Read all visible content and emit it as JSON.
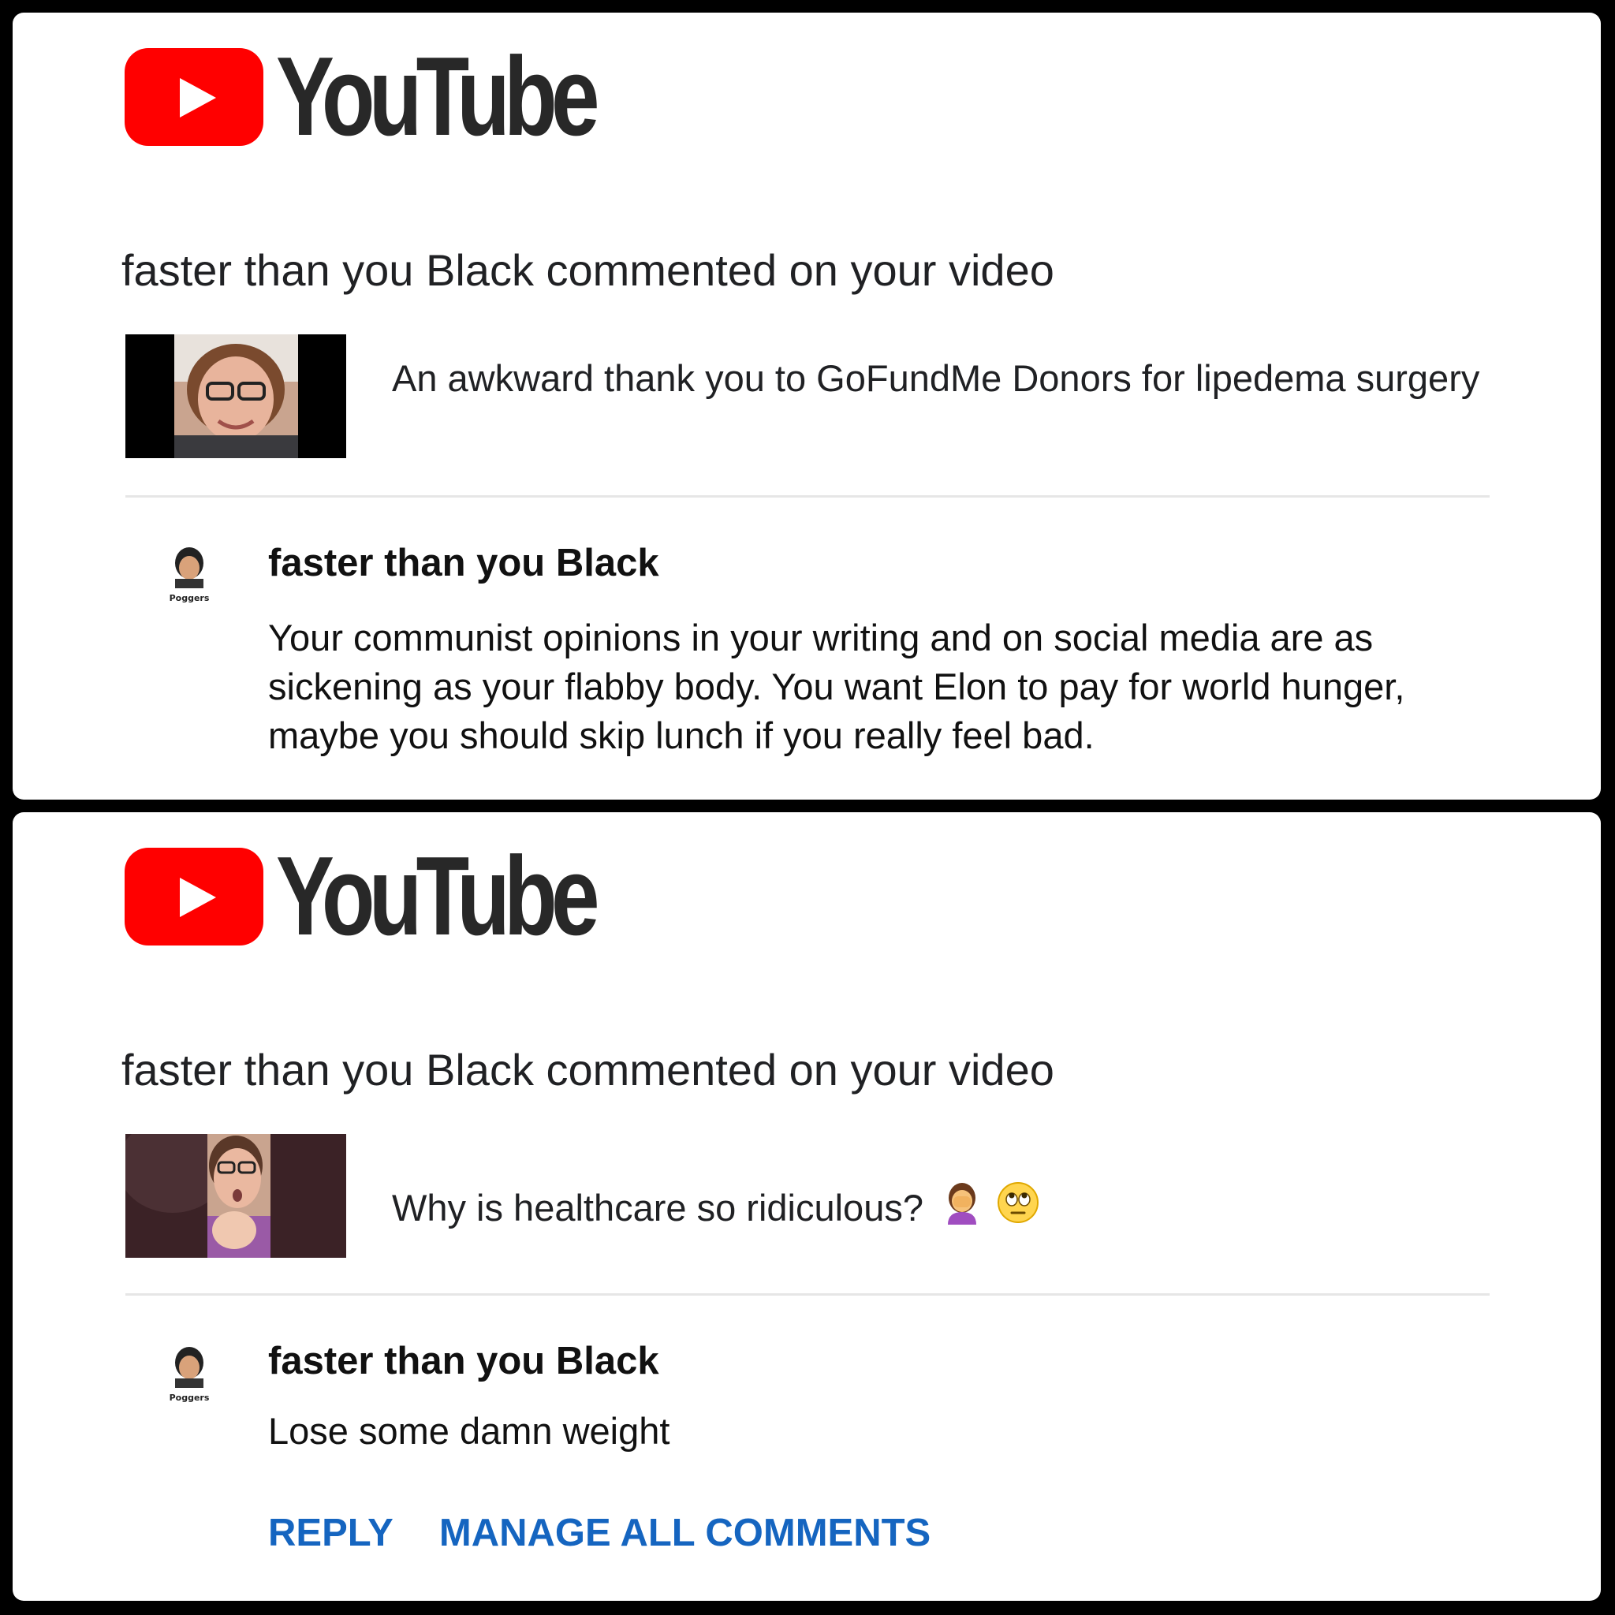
{
  "brand": {
    "name": "YouTube",
    "icon": "youtube-play-icon",
    "color": "#ff0000"
  },
  "notifications": [
    {
      "headline": "faster than you Black commented on your video",
      "video_title": "An awkward thank you to GoFundMe Donors for lipedema surgery",
      "author": "faster than you Black",
      "avatar_caption": "Poggers",
      "comment": "Your communist opinions in your writing and on social media are as sickening as your flabby body. You want Elon to pay for world hunger, maybe you should skip lunch if you really feel bad."
    },
    {
      "headline": "faster than you Black commented on your video",
      "video_title": "Why is healthcare so ridiculous?",
      "video_title_emojis": [
        "woman-facepalming-icon",
        "face-rolling-eyes-icon"
      ],
      "author": "faster than you Black",
      "avatar_caption": "Poggers",
      "comment": "Lose some damn weight",
      "actions": {
        "reply": "REPLY",
        "manage": "MANAGE ALL COMMENTS"
      }
    }
  ],
  "colors": {
    "link": "#1565c0",
    "divider": "#e6e6e6"
  }
}
